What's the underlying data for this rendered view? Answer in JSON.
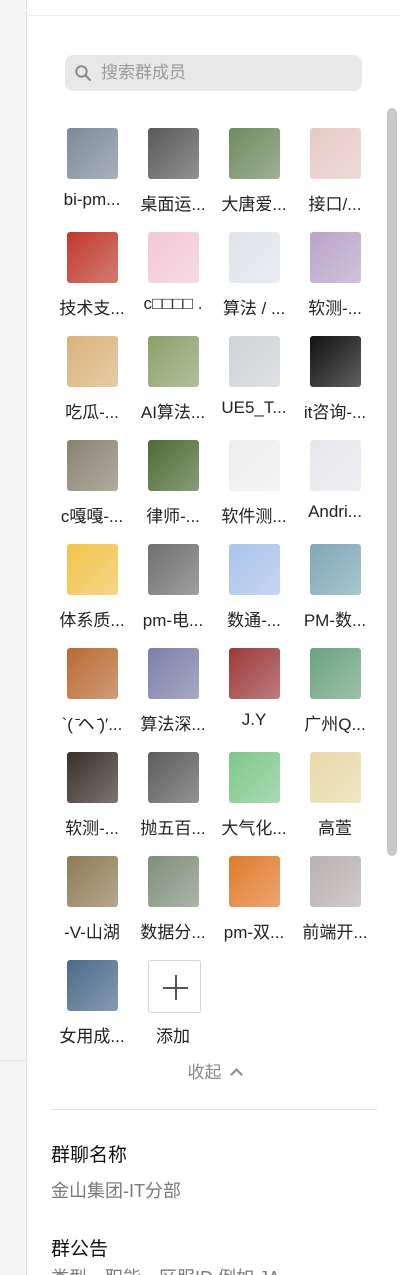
{
  "search": {
    "placeholder": "搜索群成员",
    "value": ""
  },
  "members": [
    {
      "name": "bi-pm...",
      "color": "#7c8a9a"
    },
    {
      "name": "桌面运...",
      "color": "#5a5a5a"
    },
    {
      "name": "大唐爱...",
      "color": "#6e8a5e"
    },
    {
      "name": "接口/...",
      "color": "#e7c9c4"
    },
    {
      "name": "技术支...",
      "color": "#c0392b"
    },
    {
      "name": "c□□□□ .",
      "color": "#f2c8d6"
    },
    {
      "name": "算法 / ...",
      "color": "#dfe3ea"
    },
    {
      "name": "软测-...",
      "color": "#b9a3c9"
    },
    {
      "name": "吃瓜-...",
      "color": "#d9b27a"
    },
    {
      "name": "AI算法...",
      "color": "#8aa06b"
    },
    {
      "name": "UE5_T...",
      "color": "#cfd3d6"
    },
    {
      "name": "it咨询-...",
      "color": "#111111"
    },
    {
      "name": "c嘎嘎-...",
      "color": "#8a8171"
    },
    {
      "name": "律师-...",
      "color": "#4c6b34"
    },
    {
      "name": "软件测...",
      "color": "#eeeeee"
    },
    {
      "name": "Andri...",
      "color": "#e6e6ec"
    },
    {
      "name": "体系质...",
      "color": "#f2c24a"
    },
    {
      "name": "pm-电...",
      "color": "#6f6f6f"
    },
    {
      "name": "数通-...",
      "color": "#a9c3ea"
    },
    {
      "name": "PM-数...",
      "color": "#7fa7b7"
    },
    {
      "name": "`( ̄ヘ ̄)′...",
      "color": "#b96a32"
    },
    {
      "name": "算法深...",
      "color": "#7b7fa6"
    },
    {
      "name": "J.Y",
      "color": "#9c3a3a"
    },
    {
      "name": "广州Q...",
      "color": "#6ba27e"
    },
    {
      "name": "软测-...",
      "color": "#3a2f2a"
    },
    {
      "name": "抛五百...",
      "color": "#5c5c5c"
    },
    {
      "name": "大气化...",
      "color": "#7ec78b"
    },
    {
      "name": "高萱",
      "color": "#e9d8a8"
    },
    {
      "name": "-V-山湖",
      "color": "#8f7a55"
    },
    {
      "name": "数据分...",
      "color": "#7f8f7a"
    },
    {
      "name": "pm-双...",
      "color": "#e07a2a"
    },
    {
      "name": "前端开...",
      "color": "#b9b0b0"
    },
    {
      "name": "女用成...",
      "color": "#4a6a8a"
    }
  ],
  "add_label": "添加",
  "collapse_label": "收起",
  "group_name": {
    "title": "群聊名称",
    "value": "金山集团-IT分部"
  },
  "announcement": {
    "title": "群公告",
    "value": "类型、职能、区服ID 例如 JA..."
  }
}
